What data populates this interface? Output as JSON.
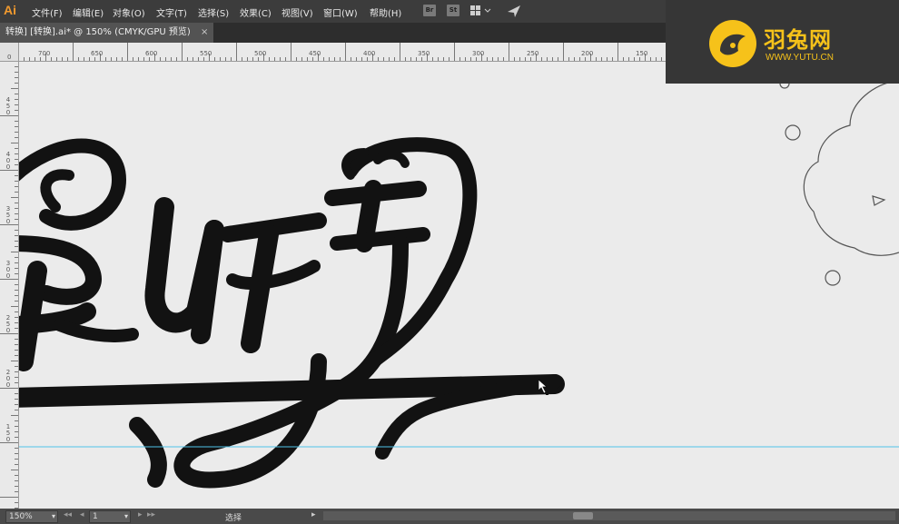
{
  "app": {
    "logo": "Ai"
  },
  "menus": [
    "文件(F)",
    "编辑(E)",
    "对象(O)",
    "文字(T)",
    "选择(S)",
    "效果(C)",
    "视图(V)",
    "窗口(W)",
    "帮助(H)"
  ],
  "toolbar_icons": [
    {
      "name": "bridge-icon",
      "label": "Br"
    },
    {
      "name": "stock-icon",
      "label": "St"
    }
  ],
  "document_tab": {
    "title": "转换] [转换].ai* @ 150% (CMYK/GPU 预览)",
    "close": "×"
  },
  "ruler_h_ticks": [
    "700",
    "650",
    "600",
    "550",
    "500",
    "450",
    "400",
    "350",
    "300",
    "250",
    "200",
    "150"
  ],
  "ruler_v_ticks": [
    "450",
    "400",
    "350",
    "300",
    "250",
    "200",
    "150"
  ],
  "ruler_corner": "0",
  "status": {
    "zoom": "150%",
    "artboard": "1",
    "tool": "选择"
  },
  "watermark": {
    "name": "羽兔网",
    "url": "WWW.YUTU.CN"
  },
  "colors": {
    "guide": "#4fc3e8",
    "artwork": "#121212",
    "brand": "#f6c21a"
  }
}
